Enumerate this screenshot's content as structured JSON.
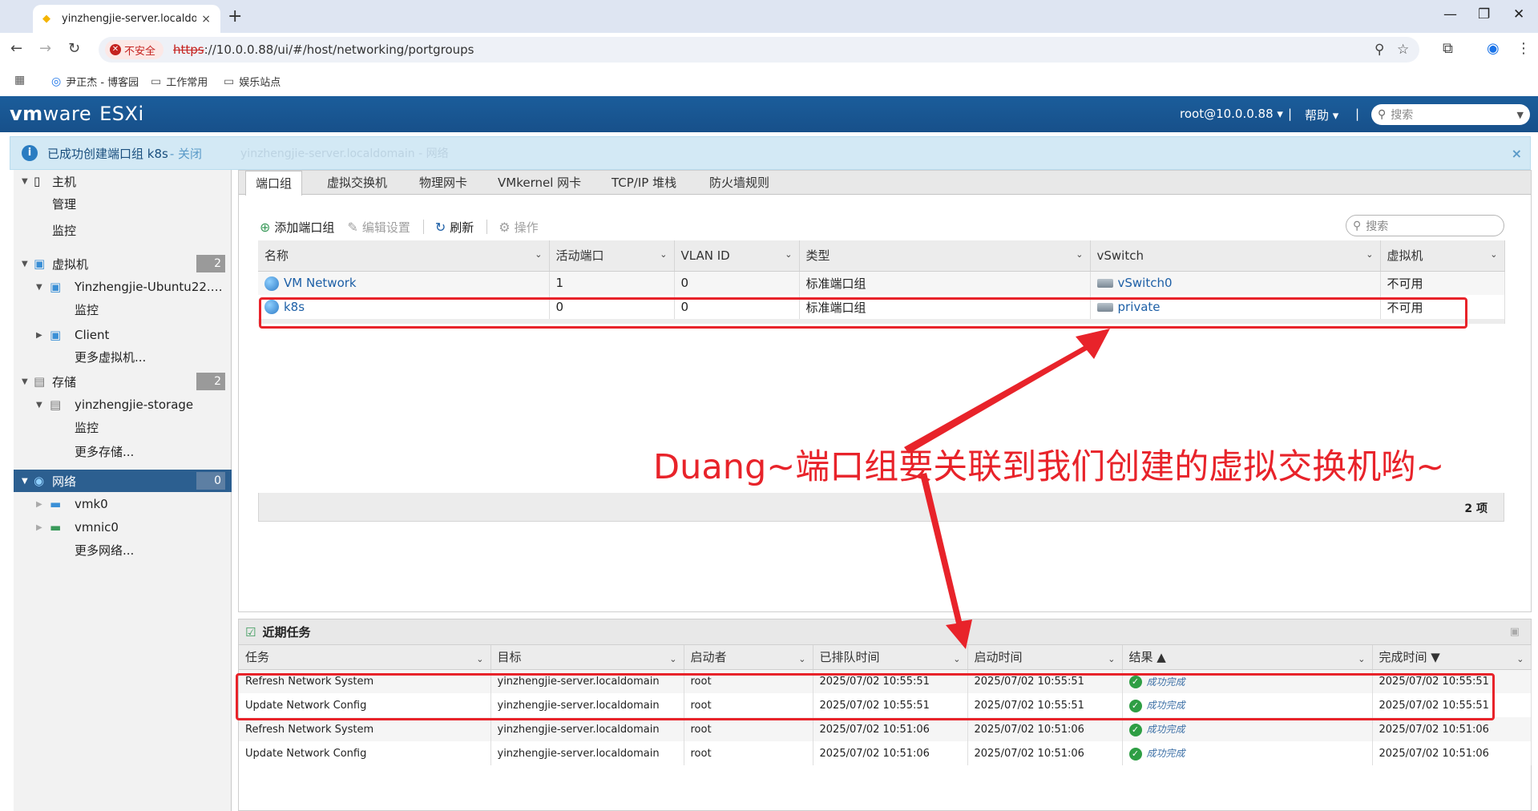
{
  "browser": {
    "tab_title": "yinzhengjie-server.localdomain",
    "tab_close": "×",
    "new_tab": "+",
    "insecure_label": "不安全",
    "url_scheme": "https",
    "url_rest": "://10.0.0.88/ui/#/host/networking/portgroups",
    "bookmarks": [
      "尹正杰 - 博客园",
      "工作常用",
      "娱乐站点"
    ]
  },
  "esxi": {
    "logo_vm": "vm",
    "logo_ware": "ware",
    "logo_product": "ESXi",
    "user": "root@10.0.0.88 ▾",
    "sep": "|",
    "help": "帮助 ▾",
    "search_placeholder": "搜索"
  },
  "notification": {
    "message": "已成功创建端口组 k8s",
    "close_link": " - 关闭",
    "ghost_text": "yinzhengjie-server.localdomain - 网络",
    "close_x": "×"
  },
  "sidebar": {
    "host": "主机",
    "manage": "管理",
    "monitor": "监控",
    "vms": "虚拟机",
    "vms_count": "2",
    "vm1": "Yinzhengjie-Ubuntu22.…",
    "vm1_monitor": "监控",
    "client": "Client",
    "more_vms": "更多虚拟机...",
    "storage": "存储",
    "storage_count": "2",
    "datastore": "yinzhengjie-storage",
    "ds_monitor": "监控",
    "more_storage": "更多存储...",
    "network": "网络",
    "network_count": "0",
    "vmk0": "vmk0",
    "vmnic0": "vmnic0",
    "more_network": "更多网络..."
  },
  "tabs": [
    "端口组",
    "虚拟交换机",
    "物理网卡",
    "VMkernel 网卡",
    "TCP/IP 堆栈",
    "防火墙规则"
  ],
  "actions": {
    "add": "添加端口组",
    "edit": "编辑设置",
    "refresh": "刷新",
    "ops": "操作",
    "search_placeholder": "搜索"
  },
  "portgroups": {
    "columns": [
      "名称",
      "活动端口",
      "VLAN ID",
      "类型",
      "vSwitch",
      "虚拟机"
    ],
    "rows": [
      {
        "name": "VM Network",
        "ports": "1",
        "vlan": "0",
        "type": "标准端口组",
        "vswitch": "vSwitch0",
        "vm": "不可用"
      },
      {
        "name": "k8s",
        "ports": "0",
        "vlan": "0",
        "type": "标准端口组",
        "vswitch": "private",
        "vm": "不可用"
      }
    ],
    "footer": "2 项"
  },
  "annotation": "Duang~端口组要关联到我们创建的虚拟交换机哟~",
  "tasks": {
    "title": "近期任务",
    "columns": [
      "任务",
      "目标",
      "启动者",
      "已排队时间",
      "启动时间",
      "结果 ▲",
      "完成时间 ▼"
    ],
    "rows": [
      {
        "task": "Refresh Network System",
        "target": "yinzhengjie-server.localdomain",
        "by": "root",
        "queued": "2025/07/02 10:55:51",
        "started": "2025/07/02 10:55:51",
        "result": "成功完成",
        "done": "2025/07/02 10:55:51"
      },
      {
        "task": "Update Network Config",
        "target": "yinzhengjie-server.localdomain",
        "by": "root",
        "queued": "2025/07/02 10:55:51",
        "started": "2025/07/02 10:55:51",
        "result": "成功完成",
        "done": "2025/07/02 10:55:51"
      },
      {
        "task": "Refresh Network System",
        "target": "yinzhengjie-server.localdomain",
        "by": "root",
        "queued": "2025/07/02 10:51:06",
        "started": "2025/07/02 10:51:06",
        "result": "成功完成",
        "done": "2025/07/02 10:51:06"
      },
      {
        "task": "Update Network Config",
        "target": "yinzhengjie-server.localdomain",
        "by": "root",
        "queued": "2025/07/02 10:51:06",
        "started": "2025/07/02 10:51:06",
        "result": "成功完成",
        "done": "2025/07/02 10:51:06"
      }
    ]
  },
  "colors": {
    "accent": "#1b5d9b",
    "annotation": "#e8232a",
    "success": "#2e9e44"
  }
}
